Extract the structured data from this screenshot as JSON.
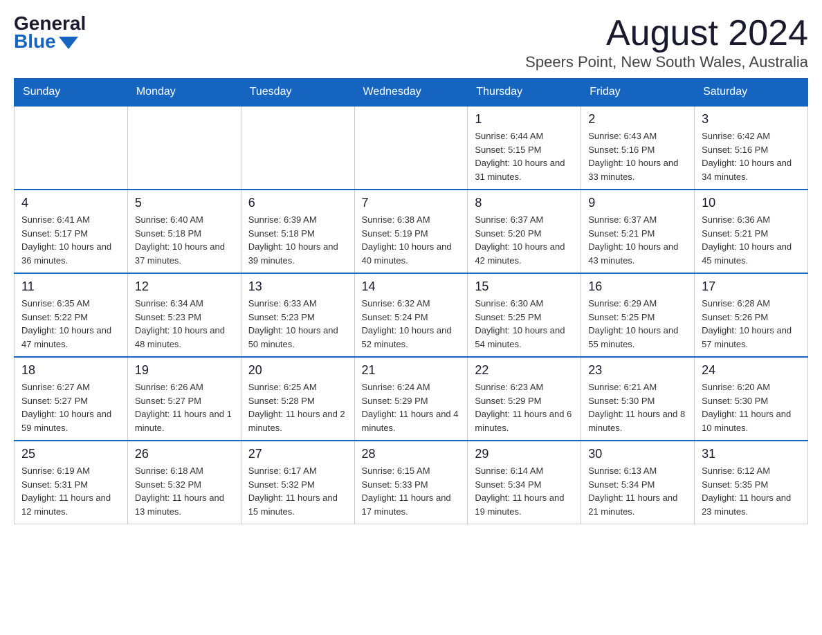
{
  "logo": {
    "general": "General",
    "blue": "Blue"
  },
  "title": {
    "month": "August 2024",
    "location": "Speers Point, New South Wales, Australia"
  },
  "days_of_week": [
    "Sunday",
    "Monday",
    "Tuesday",
    "Wednesday",
    "Thursday",
    "Friday",
    "Saturday"
  ],
  "weeks": [
    [
      {
        "day": "",
        "info": ""
      },
      {
        "day": "",
        "info": ""
      },
      {
        "day": "",
        "info": ""
      },
      {
        "day": "",
        "info": ""
      },
      {
        "day": "1",
        "info": "Sunrise: 6:44 AM\nSunset: 5:15 PM\nDaylight: 10 hours and 31 minutes."
      },
      {
        "day": "2",
        "info": "Sunrise: 6:43 AM\nSunset: 5:16 PM\nDaylight: 10 hours and 33 minutes."
      },
      {
        "day": "3",
        "info": "Sunrise: 6:42 AM\nSunset: 5:16 PM\nDaylight: 10 hours and 34 minutes."
      }
    ],
    [
      {
        "day": "4",
        "info": "Sunrise: 6:41 AM\nSunset: 5:17 PM\nDaylight: 10 hours and 36 minutes."
      },
      {
        "day": "5",
        "info": "Sunrise: 6:40 AM\nSunset: 5:18 PM\nDaylight: 10 hours and 37 minutes."
      },
      {
        "day": "6",
        "info": "Sunrise: 6:39 AM\nSunset: 5:18 PM\nDaylight: 10 hours and 39 minutes."
      },
      {
        "day": "7",
        "info": "Sunrise: 6:38 AM\nSunset: 5:19 PM\nDaylight: 10 hours and 40 minutes."
      },
      {
        "day": "8",
        "info": "Sunrise: 6:37 AM\nSunset: 5:20 PM\nDaylight: 10 hours and 42 minutes."
      },
      {
        "day": "9",
        "info": "Sunrise: 6:37 AM\nSunset: 5:21 PM\nDaylight: 10 hours and 43 minutes."
      },
      {
        "day": "10",
        "info": "Sunrise: 6:36 AM\nSunset: 5:21 PM\nDaylight: 10 hours and 45 minutes."
      }
    ],
    [
      {
        "day": "11",
        "info": "Sunrise: 6:35 AM\nSunset: 5:22 PM\nDaylight: 10 hours and 47 minutes."
      },
      {
        "day": "12",
        "info": "Sunrise: 6:34 AM\nSunset: 5:23 PM\nDaylight: 10 hours and 48 minutes."
      },
      {
        "day": "13",
        "info": "Sunrise: 6:33 AM\nSunset: 5:23 PM\nDaylight: 10 hours and 50 minutes."
      },
      {
        "day": "14",
        "info": "Sunrise: 6:32 AM\nSunset: 5:24 PM\nDaylight: 10 hours and 52 minutes."
      },
      {
        "day": "15",
        "info": "Sunrise: 6:30 AM\nSunset: 5:25 PM\nDaylight: 10 hours and 54 minutes."
      },
      {
        "day": "16",
        "info": "Sunrise: 6:29 AM\nSunset: 5:25 PM\nDaylight: 10 hours and 55 minutes."
      },
      {
        "day": "17",
        "info": "Sunrise: 6:28 AM\nSunset: 5:26 PM\nDaylight: 10 hours and 57 minutes."
      }
    ],
    [
      {
        "day": "18",
        "info": "Sunrise: 6:27 AM\nSunset: 5:27 PM\nDaylight: 10 hours and 59 minutes."
      },
      {
        "day": "19",
        "info": "Sunrise: 6:26 AM\nSunset: 5:27 PM\nDaylight: 11 hours and 1 minute."
      },
      {
        "day": "20",
        "info": "Sunrise: 6:25 AM\nSunset: 5:28 PM\nDaylight: 11 hours and 2 minutes."
      },
      {
        "day": "21",
        "info": "Sunrise: 6:24 AM\nSunset: 5:29 PM\nDaylight: 11 hours and 4 minutes."
      },
      {
        "day": "22",
        "info": "Sunrise: 6:23 AM\nSunset: 5:29 PM\nDaylight: 11 hours and 6 minutes."
      },
      {
        "day": "23",
        "info": "Sunrise: 6:21 AM\nSunset: 5:30 PM\nDaylight: 11 hours and 8 minutes."
      },
      {
        "day": "24",
        "info": "Sunrise: 6:20 AM\nSunset: 5:30 PM\nDaylight: 11 hours and 10 minutes."
      }
    ],
    [
      {
        "day": "25",
        "info": "Sunrise: 6:19 AM\nSunset: 5:31 PM\nDaylight: 11 hours and 12 minutes."
      },
      {
        "day": "26",
        "info": "Sunrise: 6:18 AM\nSunset: 5:32 PM\nDaylight: 11 hours and 13 minutes."
      },
      {
        "day": "27",
        "info": "Sunrise: 6:17 AM\nSunset: 5:32 PM\nDaylight: 11 hours and 15 minutes."
      },
      {
        "day": "28",
        "info": "Sunrise: 6:15 AM\nSunset: 5:33 PM\nDaylight: 11 hours and 17 minutes."
      },
      {
        "day": "29",
        "info": "Sunrise: 6:14 AM\nSunset: 5:34 PM\nDaylight: 11 hours and 19 minutes."
      },
      {
        "day": "30",
        "info": "Sunrise: 6:13 AM\nSunset: 5:34 PM\nDaylight: 11 hours and 21 minutes."
      },
      {
        "day": "31",
        "info": "Sunrise: 6:12 AM\nSunset: 5:35 PM\nDaylight: 11 hours and 23 minutes."
      }
    ]
  ]
}
